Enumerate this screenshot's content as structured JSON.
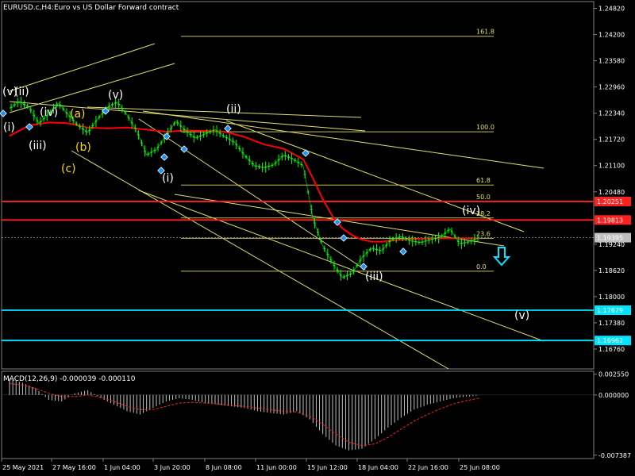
{
  "header": {
    "symbol": "EURUSD.c,H4:",
    "description": "Euro vs US Dollar Forward contract"
  },
  "colors": {
    "background": "#000000",
    "grid": "#1a3a1a",
    "candle_up": "#00ff00",
    "candle_down": "#00ff00",
    "ma": "#ff0000",
    "fib": "#c8c050",
    "trendline": "#e0e070",
    "support": "#00e5ff",
    "resistance": "#ff2020",
    "macd_hist": "#c0c0c0",
    "macd_signal": "#ff2020"
  },
  "chart_data": {
    "type": "line",
    "title": "EURUSD.c,H4:  Euro vs US Dollar Forward contract",
    "price_axis": {
      "ticks": [
        "1.24820",
        "1.24200",
        "1.23580",
        "1.22960",
        "1.22340",
        "1.21720",
        "1.21100",
        "1.20480",
        "1.19240",
        "1.18620",
        "1.18000",
        "1.17380",
        "1.16760"
      ],
      "ylim": [
        1.1629,
        1.2498
      ]
    },
    "time_axis": {
      "ticks": [
        "25 May 2021",
        "27 May 16:00",
        "1 Jun 04:00",
        "3 Jun 20:00",
        "8 Jun 08:00",
        "11 Jun 00:00",
        "15 Jun 12:00",
        "18 Jun 04:00",
        "22 Jun 16:00",
        "25 Jun 08:00"
      ]
    },
    "price_series": {
      "name": "EURUSD.c",
      "x": [
        0,
        3,
        6,
        9,
        12,
        15,
        18,
        21,
        24,
        27,
        30,
        33,
        36,
        39,
        42,
        45,
        48,
        51,
        54,
        57,
        60,
        63,
        66,
        69,
        72,
        75,
        78,
        81,
        84,
        87,
        90,
        93,
        96,
        99,
        102,
        105,
        108,
        111,
        114,
        117,
        120,
        123,
        126,
        129,
        132,
        135,
        138,
        141,
        144
      ],
      "y": [
        1.2245,
        1.2262,
        1.2248,
        1.221,
        1.2232,
        1.2258,
        1.223,
        1.2205,
        1.2188,
        1.222,
        1.2248,
        1.226,
        1.223,
        1.2192,
        1.2135,
        1.2148,
        1.218,
        1.2215,
        1.2192,
        1.2175,
        1.2185,
        1.2195,
        1.2178,
        1.2165,
        1.2135,
        1.211,
        1.2105,
        1.2112,
        1.2135,
        1.2125,
        1.211,
        1.1985,
        1.192,
        1.188,
        1.1845,
        1.1855,
        1.1892,
        1.1915,
        1.1908,
        1.1935,
        1.1942,
        1.1932,
        1.1928,
        1.1935,
        1.194,
        1.196,
        1.1925,
        1.193,
        1.194
      ]
    },
    "moving_average": {
      "x": [
        0,
        6,
        12,
        18,
        24,
        30,
        36,
        42,
        48,
        54,
        60,
        66,
        72,
        78,
        84,
        90,
        93,
        96,
        99,
        102,
        105,
        108,
        111,
        114,
        120,
        126,
        132,
        138,
        144
      ],
      "y": [
        1.218,
        1.2205,
        1.2212,
        1.221,
        1.22,
        1.2198,
        1.22,
        1.2195,
        1.219,
        1.2193,
        1.2192,
        1.219,
        1.2178,
        1.216,
        1.215,
        1.2125,
        1.208,
        1.203,
        1.199,
        1.1962,
        1.1945,
        1.1935,
        1.193,
        1.193,
        1.1935,
        1.1937,
        1.1938,
        1.1938,
        1.1938
      ]
    },
    "horizontal_levels": [
      {
        "price": 1.20251,
        "label": "1.20251",
        "color": "#ff2020"
      },
      {
        "price": 1.19813,
        "label": "1.19813",
        "color": "#ff2020"
      },
      {
        "price": 1.19395,
        "label": "1.19395",
        "color": "#c0c0c0"
      },
      {
        "price": 1.17679,
        "label": "1.17679",
        "color": "#00e5ff"
      },
      {
        "price": 1.16962,
        "label": "1.16962",
        "color": "#00e5ff"
      }
    ],
    "fibonacci_levels": [
      {
        "label": "161.8",
        "price": 1.2416
      },
      {
        "label": "100.0",
        "price": 1.219
      },
      {
        "label": "61.8",
        "price": 1.2064
      },
      {
        "label": "50.0",
        "price": 1.2025
      },
      {
        "label": "38.2",
        "price": 1.1986
      },
      {
        "label": "23.6",
        "price": 1.1938
      },
      {
        "label": "0.0",
        "price": 1.186
      }
    ],
    "wave_labels": [
      {
        "text": "(v)",
        "color": "#ffffff"
      },
      {
        "text": "(ii)",
        "color": "#ffffff"
      },
      {
        "text": "(i)",
        "color": "#ffffff"
      },
      {
        "text": "(iv)",
        "color": "#ffffff"
      },
      {
        "text": "(iii)",
        "color": "#ffffff"
      },
      {
        "text": "(a)",
        "color": "#ffd700"
      },
      {
        "text": "(b)",
        "color": "#ffd700"
      },
      {
        "text": "(c)",
        "color": "#ffd700"
      },
      {
        "text": "(v)",
        "color": "#ffffff"
      },
      {
        "text": "(ii)",
        "color": "#ffffff"
      },
      {
        "text": "(i)",
        "color": "#ffffff"
      },
      {
        "text": "(iii)",
        "color": "#ffffff"
      },
      {
        "text": "(iv)",
        "color": "#ffffff"
      },
      {
        "text": "(v)",
        "color": "#ffffff"
      }
    ],
    "macd": {
      "label": "MACD(12,26,9) -0.000039 -0.000110",
      "ticks": [
        "0.002550",
        "0.000000",
        "-0.007387"
      ],
      "hist_x": [
        0,
        4,
        8,
        12,
        16,
        20,
        24,
        28,
        32,
        36,
        40,
        44,
        48,
        52,
        56,
        60,
        64,
        68,
        72,
        76,
        80,
        84,
        88,
        92,
        96,
        100,
        104,
        108,
        112,
        116,
        120,
        124,
        128,
        132,
        136,
        140,
        144
      ],
      "hist_y": [
        0.002,
        0.0015,
        0.0008,
        -0.0006,
        -0.0008,
        0.0002,
        0.0006,
        -0.0004,
        -0.0012,
        -0.002,
        -0.0024,
        -0.0016,
        -0.0008,
        -0.0004,
        -0.0006,
        -0.001,
        -0.0012,
        -0.0014,
        -0.0016,
        -0.002,
        -0.0022,
        -0.0024,
        -0.002,
        -0.003,
        -0.0048,
        -0.0062,
        -0.0068,
        -0.0066,
        -0.0054,
        -0.004,
        -0.0028,
        -0.0018,
        -0.0012,
        -0.0008,
        -0.0004,
        -0.0002,
        -0.0001
      ],
      "signal_y": [
        0.0014,
        0.0012,
        0.0008,
        0.0002,
        -0.0002,
        -0.0002,
        0.0,
        -0.0003,
        -0.0008,
        -0.0014,
        -0.0018,
        -0.0018,
        -0.0014,
        -0.001,
        -0.0009,
        -0.001,
        -0.0011,
        -0.0013,
        -0.0014,
        -0.0016,
        -0.0018,
        -0.002,
        -0.0021,
        -0.0026,
        -0.0036,
        -0.0048,
        -0.0058,
        -0.0062,
        -0.006,
        -0.0052,
        -0.0042,
        -0.0032,
        -0.0024,
        -0.0017,
        -0.0011,
        -0.0007,
        -0.0004
      ],
      "ylim": [
        -0.0078,
        0.0029
      ]
    }
  }
}
